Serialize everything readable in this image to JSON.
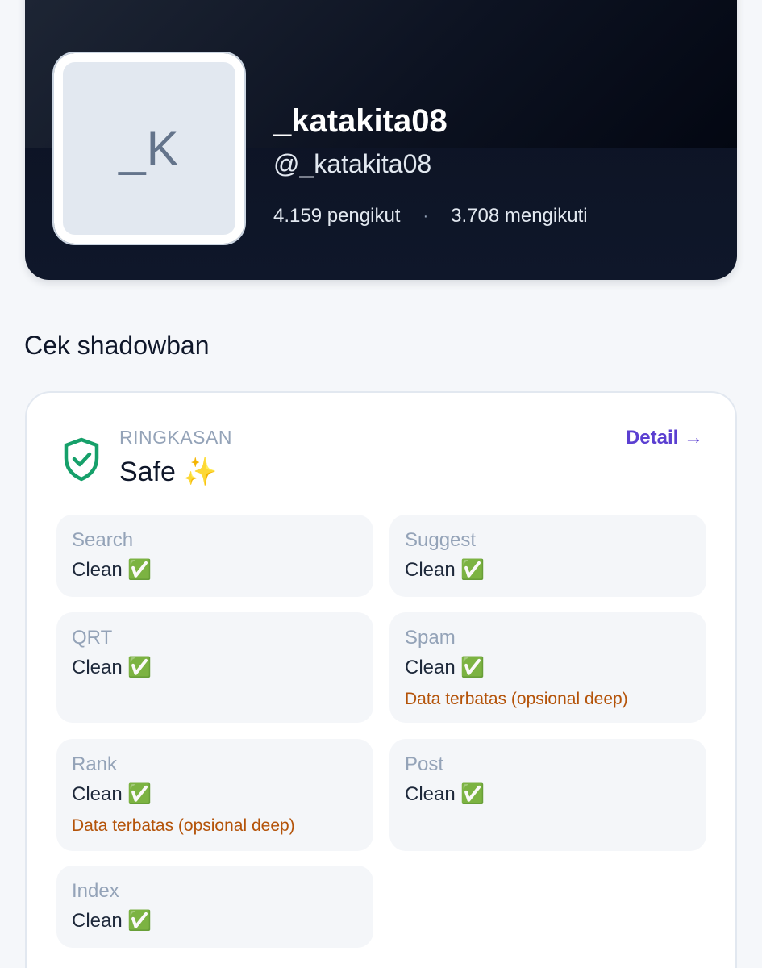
{
  "profile": {
    "avatar_initials": "_K",
    "display_name": "_katakita08",
    "handle": "@_katakita08",
    "followers": "4.159 pengikut",
    "separator": "·",
    "following": "3.708 mengikuti"
  },
  "section": {
    "title": "Cek shadowban"
  },
  "summary": {
    "label": "RINGKASAN",
    "value": "Safe ✨",
    "detail_link": "Detail →",
    "icon": "shield-check-icon",
    "accent_color": "#16a06a"
  },
  "checks": [
    {
      "name": "Search",
      "status": "Clean ✅",
      "note": ""
    },
    {
      "name": "Suggest",
      "status": "Clean ✅",
      "note": ""
    },
    {
      "name": "QRT",
      "status": "Clean ✅",
      "note": ""
    },
    {
      "name": "Spam",
      "status": "Clean ✅",
      "note": "Data terbatas (opsional deep)"
    },
    {
      "name": "Rank",
      "status": "Clean ✅",
      "note": "Data terbatas (opsional deep)"
    },
    {
      "name": "Post",
      "status": "Clean ✅",
      "note": ""
    },
    {
      "name": "Index",
      "status": "Clean ✅",
      "note": ""
    }
  ],
  "colors": {
    "header_bg": "#0f172a",
    "link": "#5b3fd1",
    "note": "#b45309",
    "muted": "#94a3b8"
  }
}
